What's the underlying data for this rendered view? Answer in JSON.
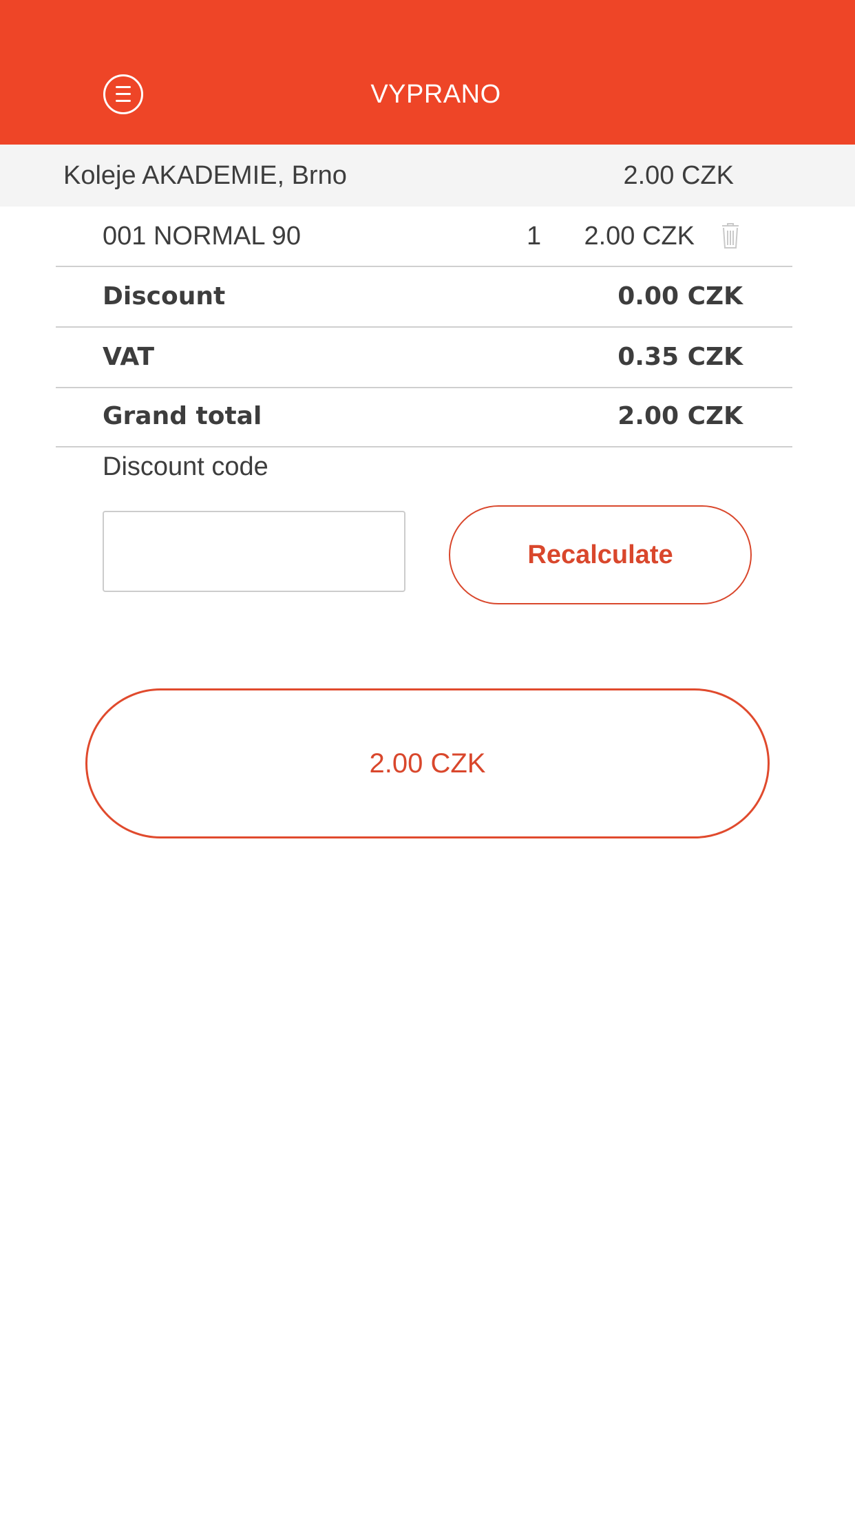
{
  "header": {
    "title": "VYPRANO",
    "menu_icon": "menu-icon",
    "color": "#ee4527"
  },
  "location": {
    "name": "Koleje AKADEMIE, Brno",
    "price": "2.00 CZK"
  },
  "cart": {
    "items": [
      {
        "name": "001 NORMAL 90",
        "quantity": "1",
        "price": "2.00 CZK",
        "delete_icon": "trash-icon"
      }
    ]
  },
  "summary": {
    "discount_label": "Discount",
    "discount_value": "0.00 CZK",
    "vat_label": "VAT",
    "vat_value": "0.35 CZK",
    "total_label": "Grand total",
    "total_value": "2.00 CZK"
  },
  "discount_code": {
    "label": "Discount code",
    "value": "",
    "button_label": "Recalculate"
  },
  "pay_button": {
    "label": "2.00 CZK"
  },
  "colors": {
    "accent": "#ee4527",
    "button_outline": "#d9472c",
    "text": "#3d3d3d",
    "divider": "#cfcfcf",
    "location_bg": "#f4f4f4"
  }
}
